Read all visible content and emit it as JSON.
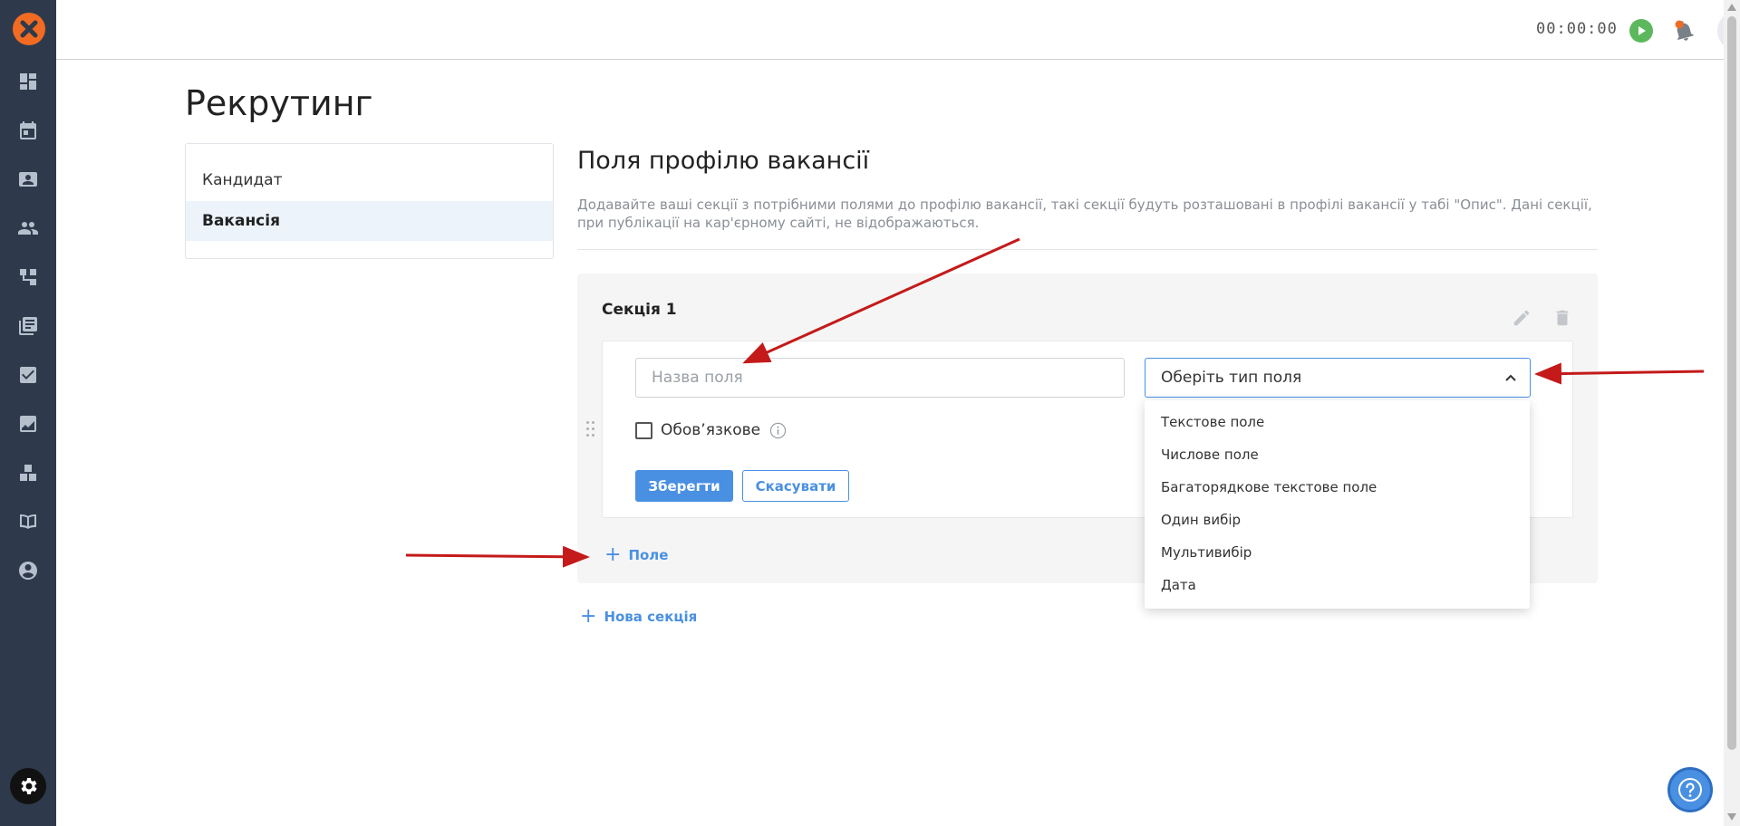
{
  "sidebar": {
    "items": [
      {
        "icon": "dashboard-icon"
      },
      {
        "icon": "calendar-icon"
      },
      {
        "icon": "contacts-icon"
      },
      {
        "icon": "people-icon"
      },
      {
        "icon": "workflow-icon"
      },
      {
        "icon": "library-icon"
      },
      {
        "icon": "checklist-icon"
      },
      {
        "icon": "analytics-icon"
      },
      {
        "icon": "integrations-icon"
      },
      {
        "icon": "book-icon"
      },
      {
        "icon": "profile-icon"
      }
    ],
    "settings_icon": "gear-icon"
  },
  "topbar": {
    "timer": "00:00:00"
  },
  "page": {
    "title": "Рекрутинг"
  },
  "subnav": {
    "items": [
      {
        "label": "Кандидат"
      },
      {
        "label": "Вакансія"
      }
    ]
  },
  "main": {
    "title": "Поля профілю вакансії",
    "description": "Додавайте ваші секції з потрібними полями до профілю вакансії, такі секції будуть розташовані в профілі вакансії у табі \"Опис\". Дані секції, при публікації на кар'єрному сайті, не відображаються.",
    "section": {
      "title": "Секція 1",
      "field": {
        "name_placeholder": "Назва поля",
        "type_placeholder": "Оберіть тип поля",
        "required_label": "Обов’язкове",
        "save_label": "Зберегти",
        "cancel_label": "Скасувати"
      },
      "add_field_label": "Поле"
    },
    "add_section_label": "Нова секція"
  },
  "dropdown": {
    "options": [
      "Текстове поле",
      "Числове поле",
      "Багаторядкове текстове поле",
      "Один вибір",
      "Мультивибір",
      "Дата"
    ]
  },
  "colors": {
    "accent": "#4a90e2",
    "sidebar_bg": "#2e3a4b",
    "logo": "#f26b22",
    "annotation_arrow": "#c41a1a"
  }
}
